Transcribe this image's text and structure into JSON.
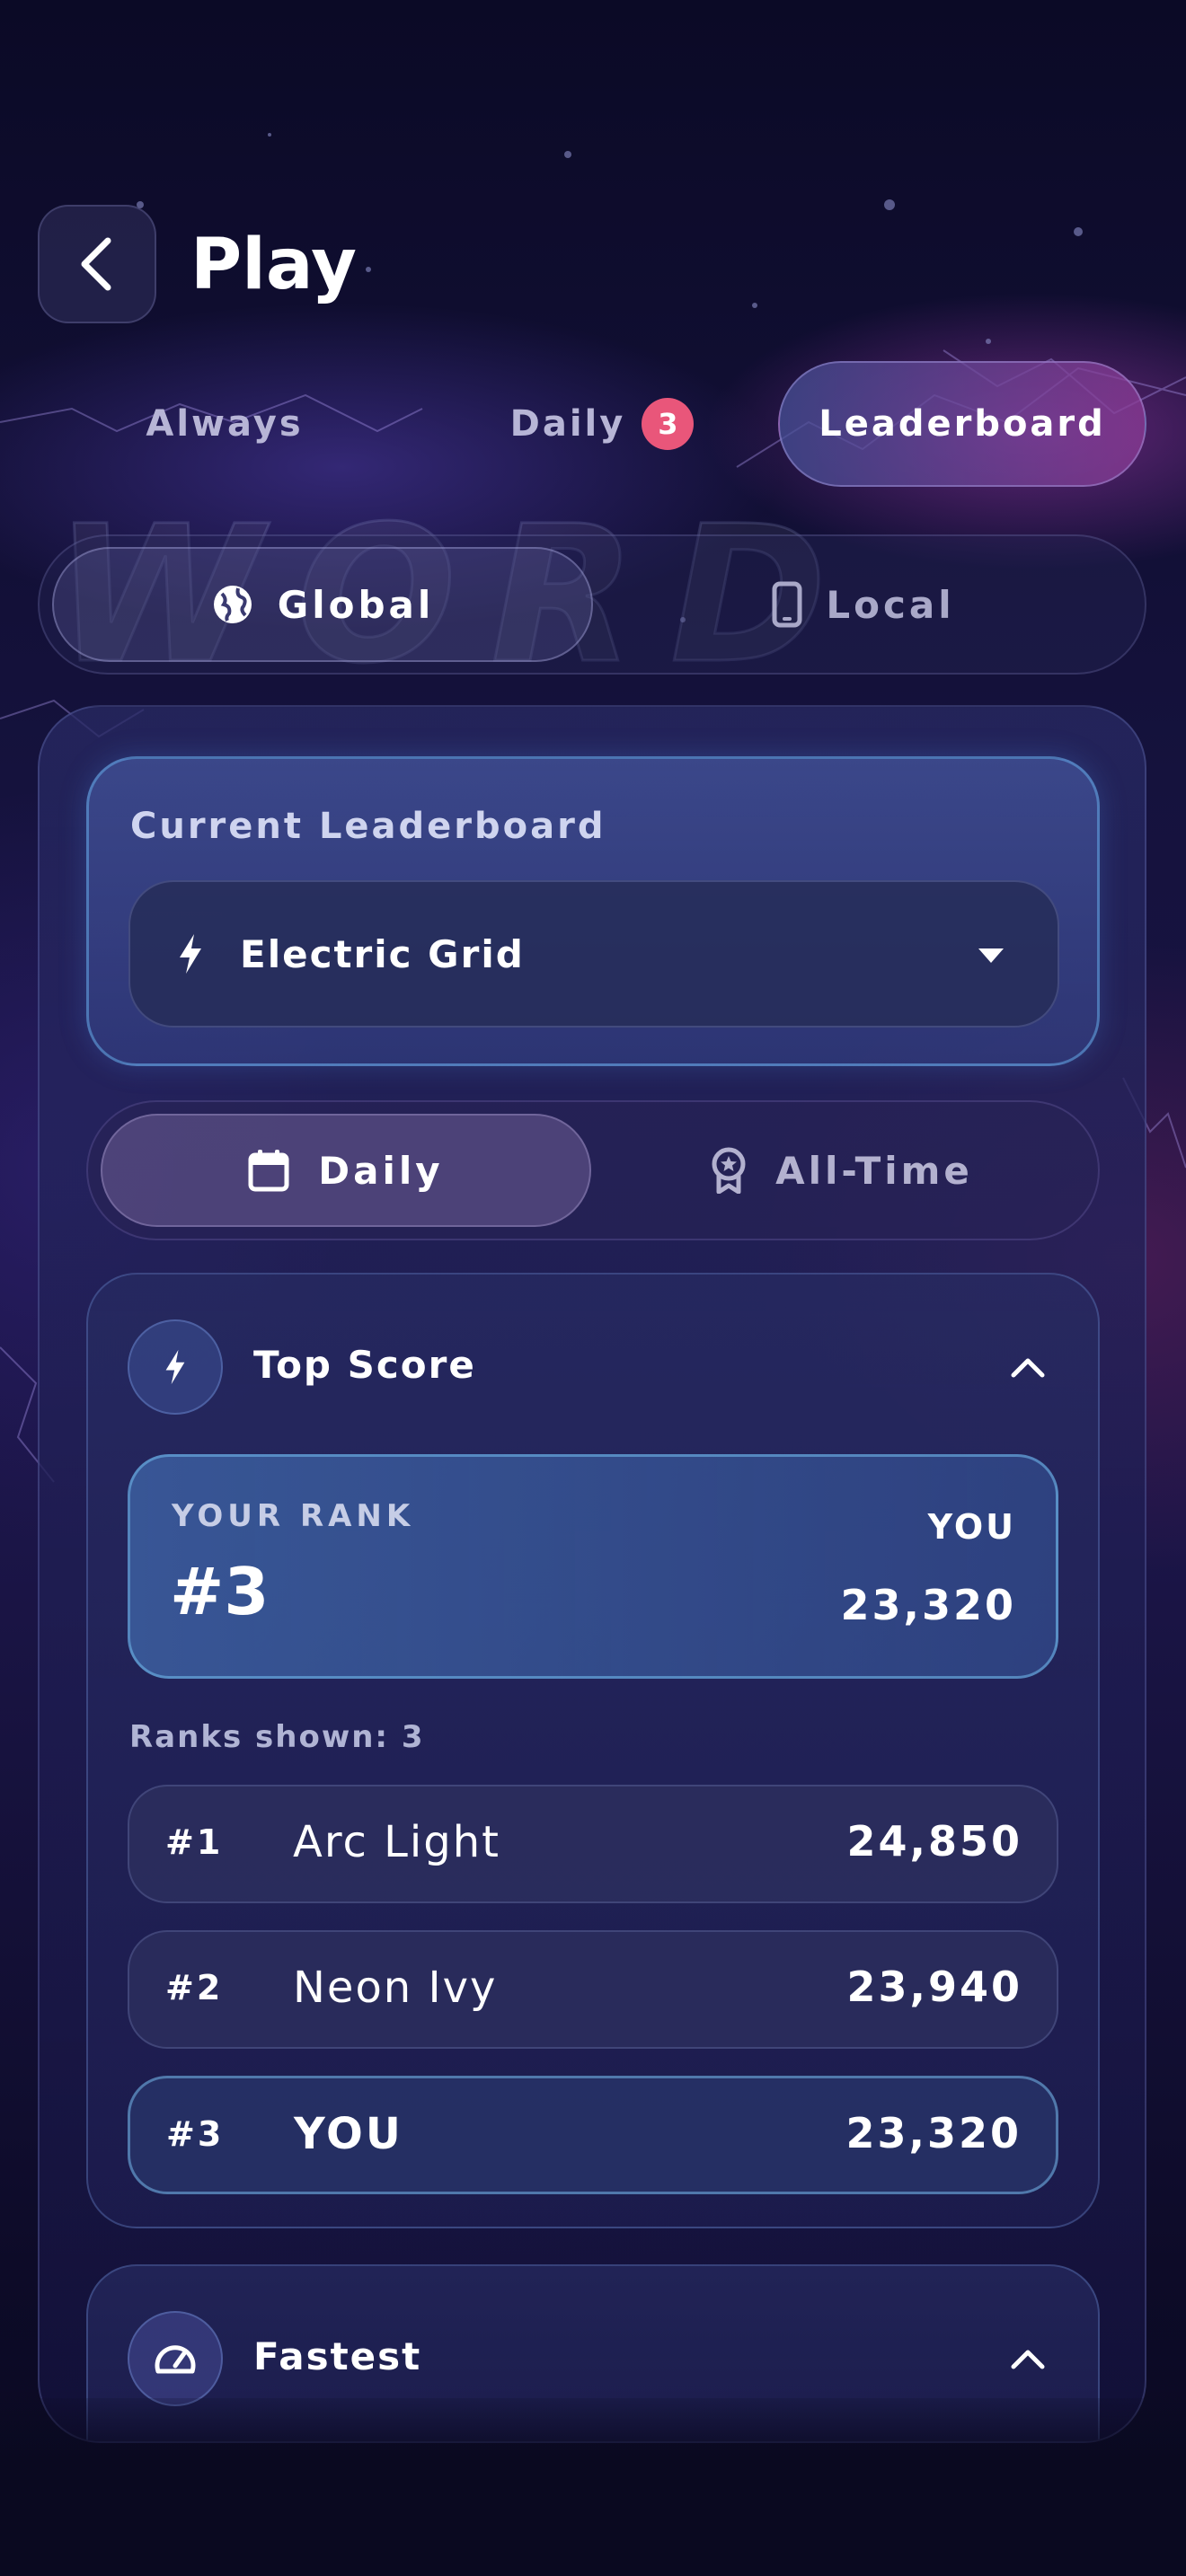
{
  "header": {
    "title": "Play"
  },
  "tabs": [
    {
      "label": "Always",
      "active": false
    },
    {
      "label": "Daily",
      "badge": "3",
      "active": false
    },
    {
      "label": "Leaderboard",
      "active": true
    }
  ],
  "background_word": [
    "W",
    "O",
    "R",
    "D"
  ],
  "scope": {
    "options": [
      {
        "label": "Global",
        "icon": "globe-icon",
        "active": true
      },
      {
        "label": "Local",
        "icon": "phone-icon",
        "active": false
      }
    ]
  },
  "leaderboard": {
    "label": "Current Leaderboard",
    "selected": "Electric Grid",
    "selected_icon": "bolt-icon"
  },
  "period": {
    "options": [
      {
        "label": "Daily",
        "icon": "calendar-icon",
        "active": true
      },
      {
        "label": "All-Time",
        "icon": "award-icon",
        "active": false
      }
    ]
  },
  "top_score": {
    "title": "Top Score",
    "icon": "bolt-icon",
    "your_rank_label": "YOUR RANK",
    "your_rank": "#3",
    "you_label": "YOU",
    "your_score": "23,320",
    "ranks_shown": "Ranks shown: 3",
    "rows": [
      {
        "rank": "#1",
        "name": "Arc Light",
        "score": "24,850",
        "me": false
      },
      {
        "rank": "#2",
        "name": "Neon Ivy",
        "score": "23,940",
        "me": false
      },
      {
        "rank": "#3",
        "name": "YOU",
        "score": "23,320",
        "me": true
      }
    ]
  },
  "fastest": {
    "title": "Fastest",
    "icon": "speedometer-icon"
  },
  "colors": {
    "badge": "#e9567a",
    "accent_border": "#6eb4e6",
    "background": "#0b0a24"
  }
}
